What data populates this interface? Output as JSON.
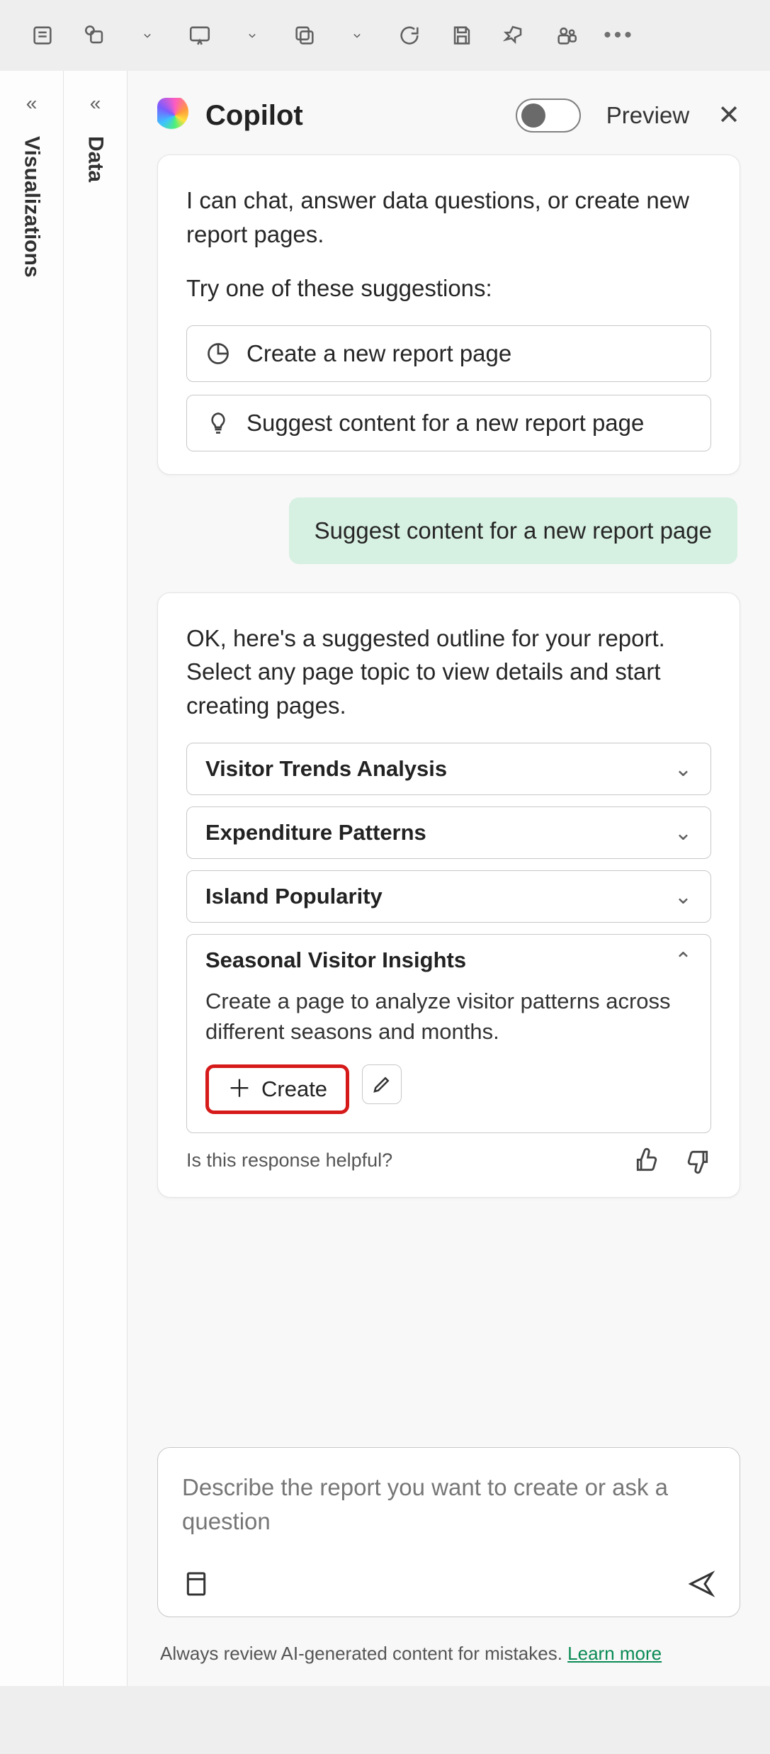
{
  "toolbar_icons": [
    "panel",
    "copy",
    "chev",
    "present",
    "chev",
    "duplicate",
    "chev",
    "refresh",
    "save",
    "pin",
    "teams",
    "more"
  ],
  "sidebar": {
    "tabs": [
      {
        "label": "Data"
      },
      {
        "label": "Visualizations"
      }
    ]
  },
  "pane_title": "Copilot",
  "preview_label": "Preview",
  "intro": {
    "greeting": "I can chat, answer data questions, or create new report pages.",
    "try_line": "Try one of these suggestions:",
    "suggestions": [
      {
        "icon": "pie",
        "label": "Create a new report page"
      },
      {
        "icon": "bulb",
        "label": "Suggest content for a new report page"
      }
    ]
  },
  "user_message": "Suggest content for a new report page",
  "outline": {
    "preamble": "OK, here's a suggested outline for your report. Select any page topic to view details and start creating pages.",
    "topics": [
      {
        "title": "Visitor Trends Analysis",
        "expanded": false
      },
      {
        "title": "Expenditure Patterns",
        "expanded": false
      },
      {
        "title": "Island Popularity",
        "expanded": false
      },
      {
        "title": "Seasonal Visitor Insights",
        "expanded": true,
        "description": "Create a page to analyze visitor patterns across different seasons and months.",
        "create_label": "Create"
      }
    ],
    "feedback_prompt": "Is this response helpful?"
  },
  "input": {
    "placeholder": "Describe the report you want to create or ask a question"
  },
  "footer": {
    "note": "Always review AI-generated content for mistakes. ",
    "link": "Learn more"
  }
}
